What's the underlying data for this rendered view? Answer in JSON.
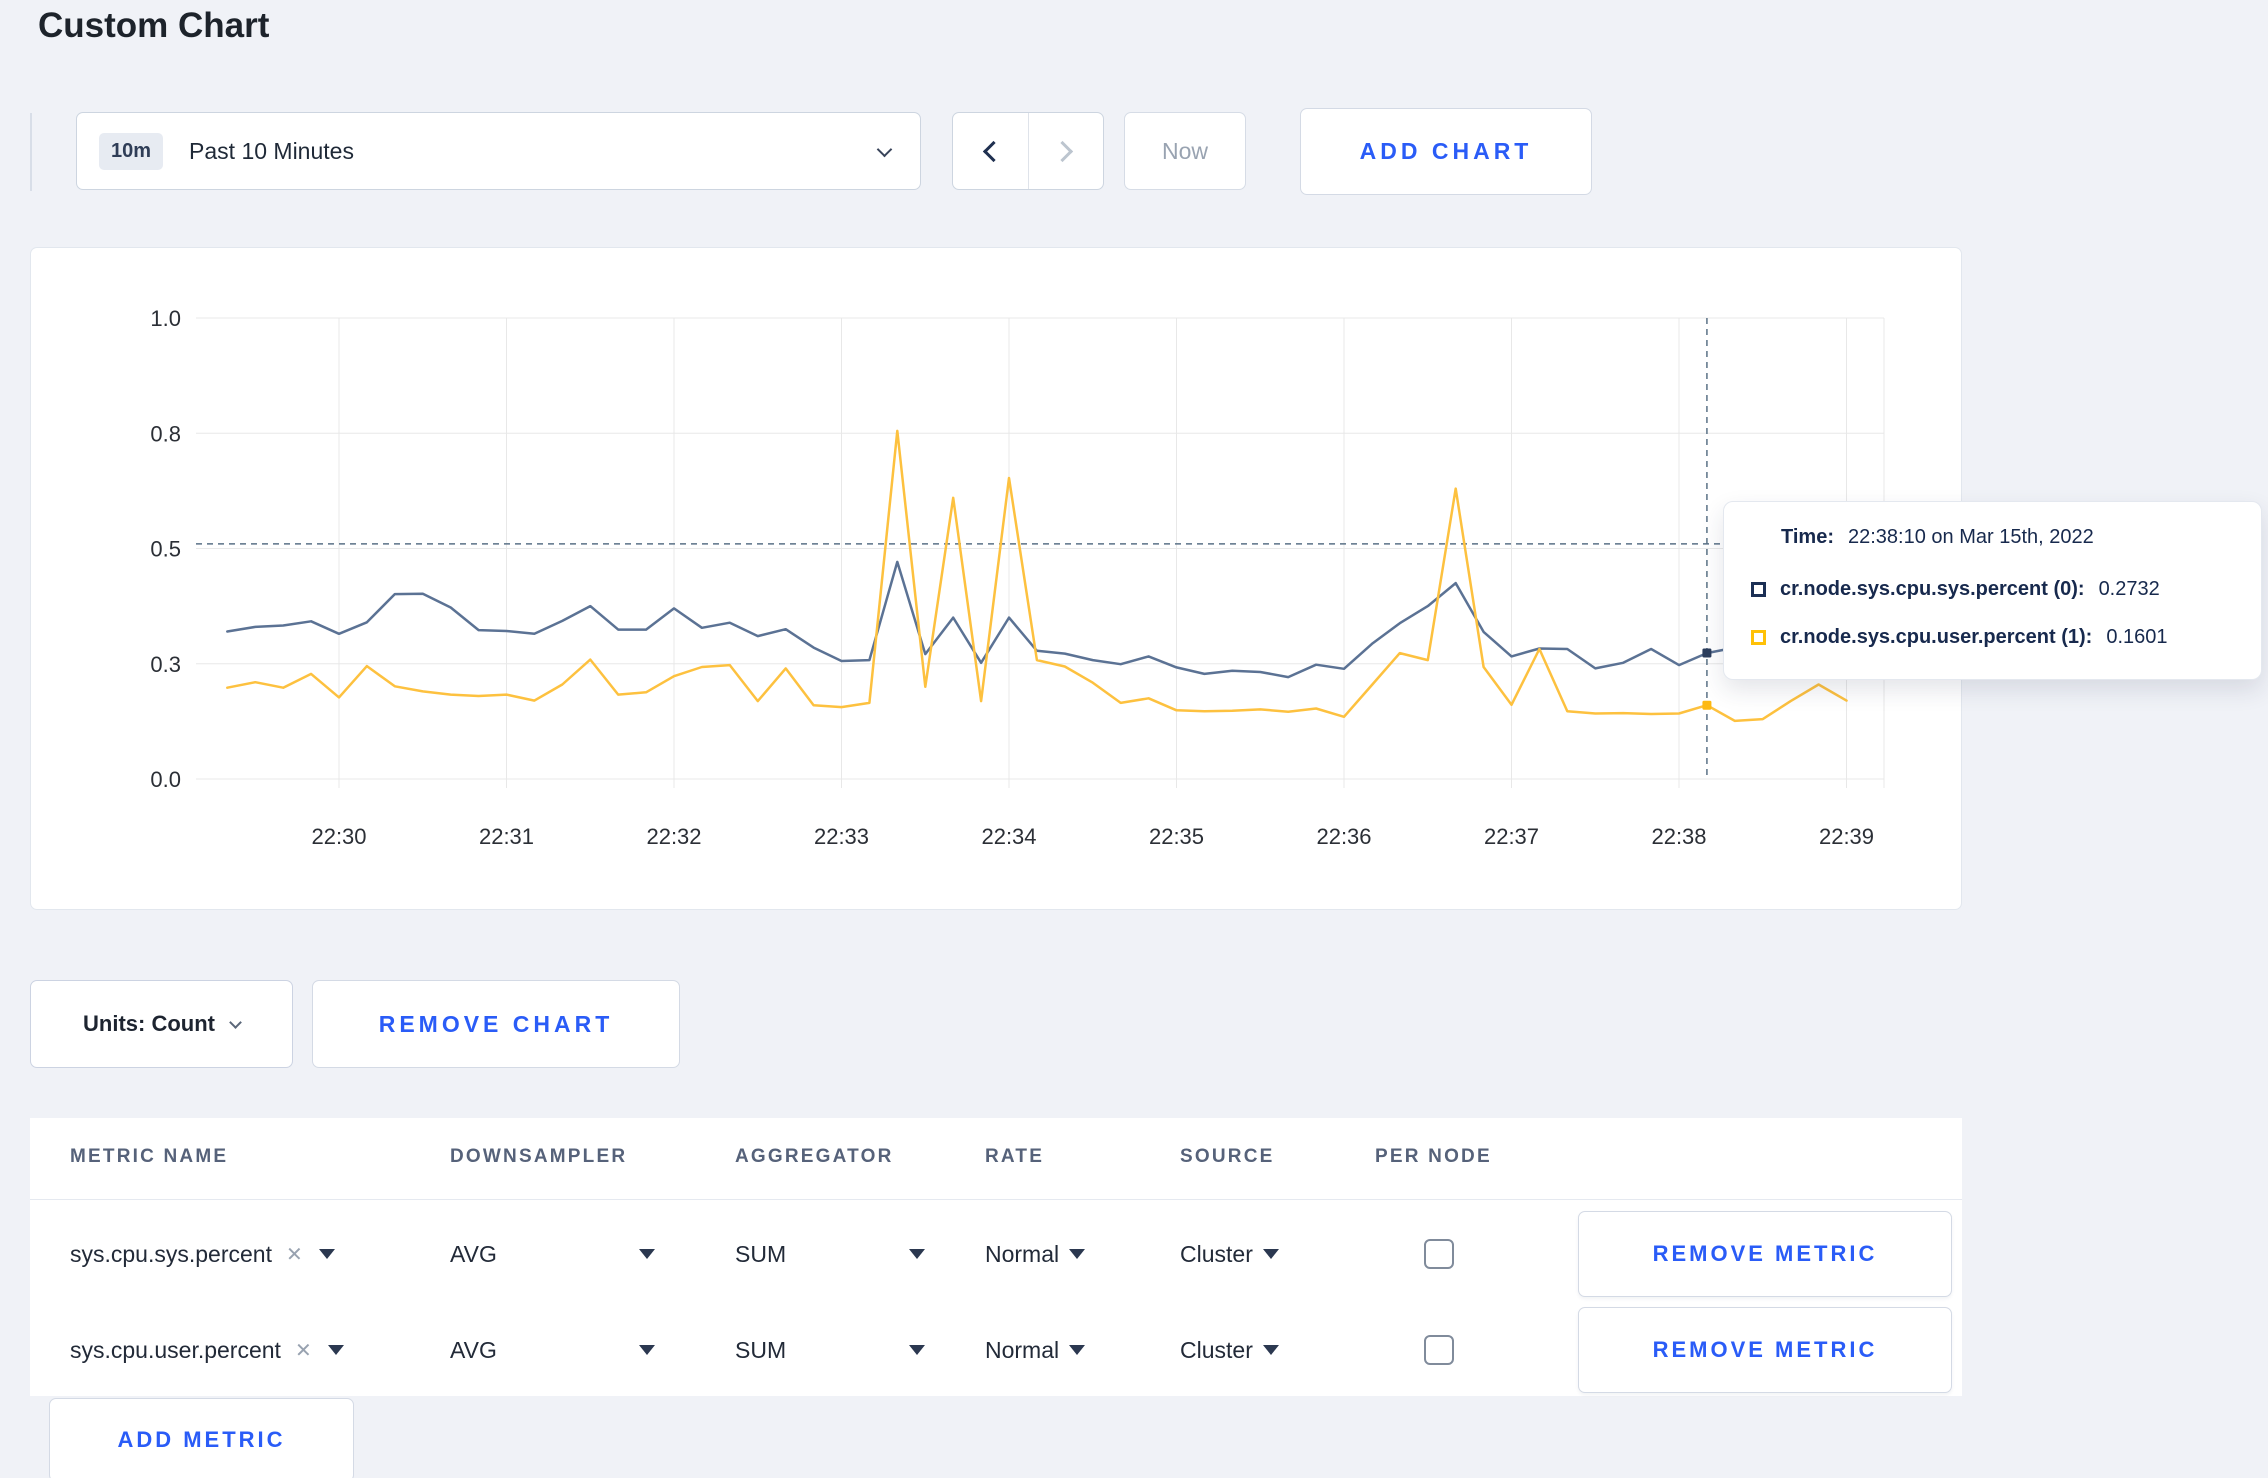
{
  "page": {
    "title": "Custom Chart"
  },
  "toolbar": {
    "time_range": {
      "badge": "10m",
      "label": "Past 10 Minutes"
    },
    "now_label": "Now",
    "add_chart_label": "ADD CHART"
  },
  "icons": {
    "clear": "✕"
  },
  "colors": {
    "accent_blue": "#2a5cf7",
    "series_sys_line": "#5b7294",
    "series_user_line": "#fdc13f",
    "tooltip_sys_swatch": "#1b2f54",
    "tooltip_user_swatch": "#ffc107"
  },
  "tooltip": {
    "time_label": "Time:",
    "time_value": "22:38:10 on Mar 15th, 2022",
    "series": [
      {
        "name": "cr.node.sys.cpu.sys.percent (0):",
        "value": "0.2732",
        "color": "#1b2f54"
      },
      {
        "name": "cr.node.sys.cpu.user.percent (1):",
        "value": "0.1601",
        "color": "#ffc107"
      }
    ]
  },
  "chart_actions": {
    "units_label": "Units: Count",
    "remove_chart_label": "REMOVE CHART"
  },
  "metrics_table": {
    "headers": [
      "METRIC NAME",
      "DOWNSAMPLER",
      "AGGREGATOR",
      "RATE",
      "SOURCE",
      "PER NODE"
    ],
    "rows": [
      {
        "metric": "sys.cpu.sys.percent",
        "downsampler": "AVG",
        "aggregator": "SUM",
        "rate": "Normal",
        "source": "Cluster",
        "per_node": false,
        "remove_label": "REMOVE METRIC"
      },
      {
        "metric": "sys.cpu.user.percent",
        "downsampler": "AVG",
        "aggregator": "SUM",
        "rate": "Normal",
        "source": "Cluster",
        "per_node": false,
        "remove_label": "REMOVE METRIC"
      }
    ],
    "add_metric_label": "ADD METRIC"
  },
  "chart_data": {
    "type": "line",
    "title": "",
    "xlabel": "",
    "ylabel": "",
    "ylim": [
      0,
      1
    ],
    "grid": true,
    "legend_position": "tooltip-only",
    "x_tick_labels": [
      "22:30",
      "22:31",
      "22:32",
      "22:33",
      "22:34",
      "22:35",
      "22:36",
      "22:37",
      "22:38",
      "22:39"
    ],
    "y_ticks": [
      {
        "value": 0,
        "label": "0.0"
      },
      {
        "value": 0.25,
        "label": "0.3"
      },
      {
        "value": 0.5,
        "label": "0.5"
      },
      {
        "value": 0.75,
        "label": "0.8"
      },
      {
        "value": 1,
        "label": "1.0"
      }
    ],
    "x": [
      "22:29:20",
      "22:29:30",
      "22:29:40",
      "22:29:50",
      "22:30:00",
      "22:30:10",
      "22:30:20",
      "22:30:30",
      "22:30:40",
      "22:30:50",
      "22:31:00",
      "22:31:10",
      "22:31:20",
      "22:31:30",
      "22:31:40",
      "22:31:50",
      "22:32:00",
      "22:32:10",
      "22:32:20",
      "22:32:30",
      "22:32:40",
      "22:32:50",
      "22:33:00",
      "22:33:10",
      "22:33:20",
      "22:33:30",
      "22:33:40",
      "22:33:50",
      "22:34:00",
      "22:34:10",
      "22:34:20",
      "22:34:30",
      "22:34:40",
      "22:34:50",
      "22:35:00",
      "22:35:10",
      "22:35:20",
      "22:35:30",
      "22:35:40",
      "22:35:50",
      "22:36:00",
      "22:36:10",
      "22:36:20",
      "22:36:30",
      "22:36:40",
      "22:36:50",
      "22:37:00",
      "22:37:10",
      "22:37:20",
      "22:37:30",
      "22:37:40",
      "22:37:50",
      "22:38:00",
      "22:38:10",
      "22:38:20",
      "22:38:30",
      "22:38:40",
      "22:38:50",
      "22:39:00"
    ],
    "series": [
      {
        "name": "cr.node.sys.cpu.sys.percent",
        "color": "#5b7294",
        "values": [
          0.32,
          0.33,
          0.333,
          0.342,
          0.315,
          0.34,
          0.401,
          0.402,
          0.372,
          0.323,
          0.321,
          0.315,
          0.343,
          0.375,
          0.324,
          0.324,
          0.37,
          0.328,
          0.339,
          0.31,
          0.325,
          0.285,
          0.256,
          0.258,
          0.471,
          0.271,
          0.35,
          0.252,
          0.35,
          0.278,
          0.272,
          0.258,
          0.249,
          0.266,
          0.242,
          0.228,
          0.235,
          0.232,
          0.221,
          0.248,
          0.239,
          0.293,
          0.338,
          0.375,
          0.425,
          0.319,
          0.266,
          0.283,
          0.282,
          0.24,
          0.252,
          0.282,
          0.247,
          0.2732,
          0.285,
          0.29,
          0.295,
          0.3,
          0.295
        ]
      },
      {
        "name": "cr.node.sys.cpu.user.percent",
        "color": "#fdc13f",
        "values": [
          0.198,
          0.21,
          0.198,
          0.228,
          0.177,
          0.245,
          0.201,
          0.19,
          0.183,
          0.18,
          0.183,
          0.17,
          0.205,
          0.259,
          0.183,
          0.188,
          0.223,
          0.243,
          0.247,
          0.169,
          0.24,
          0.16,
          0.156,
          0.165,
          0.755,
          0.2,
          0.61,
          0.169,
          0.653,
          0.258,
          0.244,
          0.209,
          0.165,
          0.175,
          0.149,
          0.147,
          0.148,
          0.151,
          0.146,
          0.153,
          0.135,
          0.204,
          0.273,
          0.258,
          0.63,
          0.243,
          0.161,
          0.282,
          0.147,
          0.142,
          0.143,
          0.141,
          0.142,
          0.1601,
          0.126,
          0.13,
          0.169,
          0.205,
          0.17
        ]
      }
    ],
    "crosshair": {
      "time": "22:38:10",
      "x_offset_min": 8.1667,
      "h_value": 0.51,
      "points": [
        {
          "value": 0.2732,
          "color": "#2c3e5d"
        },
        {
          "value": 0.1601,
          "color": "#fdb913"
        }
      ]
    }
  }
}
